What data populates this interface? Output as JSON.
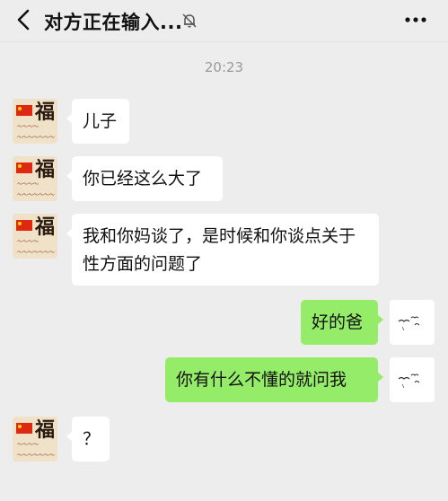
{
  "header": {
    "back_icon": "chevron-left-icon",
    "title": "对方正在输入...",
    "mute_icon": "bell-off-icon",
    "more_icon": "ellipsis-icon"
  },
  "chat": {
    "timestamp": "20:23",
    "messages": [
      {
        "side": "left",
        "text": "儿子"
      },
      {
        "side": "left",
        "text": "你已经这么大了"
      },
      {
        "side": "left",
        "text": "我和你妈谈了，是时候和你谈点关于性方面的问题了"
      },
      {
        "side": "right",
        "text": "好的爸"
      },
      {
        "side": "right",
        "text": "你有什么不懂的就问我"
      },
      {
        "side": "left",
        "text": "？"
      }
    ]
  },
  "colors": {
    "background": "#ededed",
    "incoming_bubble": "#ffffff",
    "outgoing_bubble": "#95ec69"
  }
}
